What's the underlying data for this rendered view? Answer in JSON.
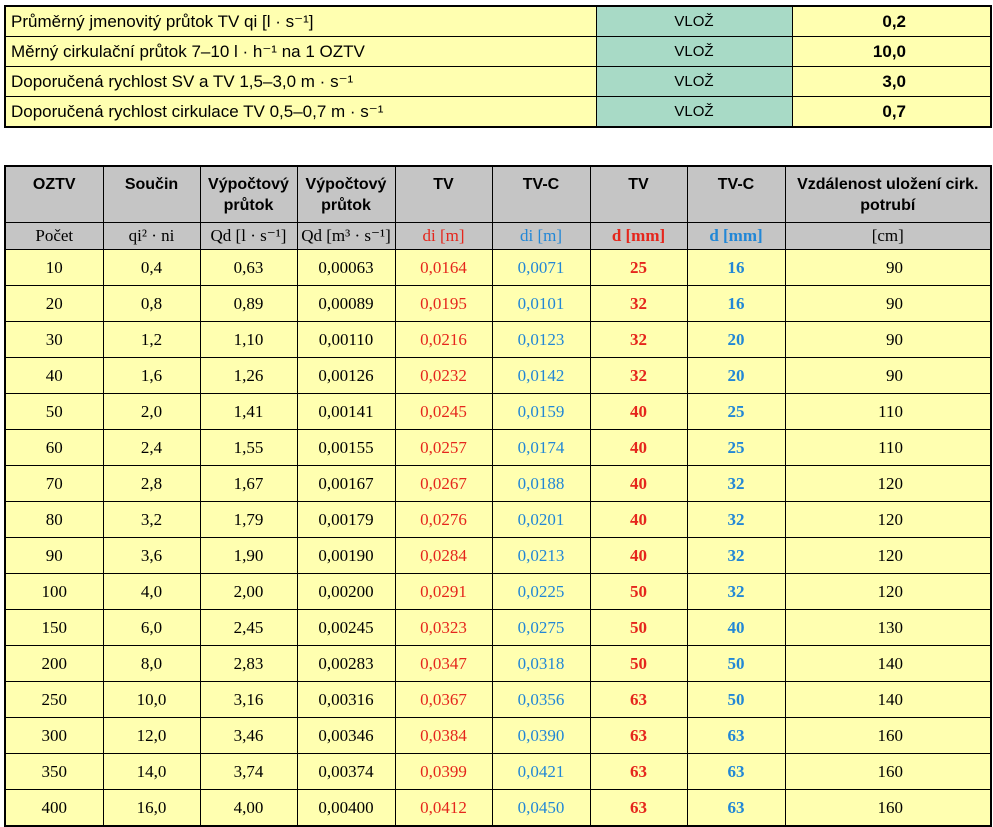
{
  "params": [
    {
      "label": "Průměrný jmenovitý průtok TV qi  [l · s⁻¹]",
      "button": "VLOŽ",
      "value": "0,2"
    },
    {
      "label": "Měrný cirkulační průtok 7–10 l · h⁻¹ na 1 OZTV",
      "button": "VLOŽ",
      "value": "10,0"
    },
    {
      "label": "Doporučená rychlost SV a TV 1,5–3,0 m · s⁻¹",
      "button": "VLOŽ",
      "value": "3,0"
    },
    {
      "label": "Doporučená rychlost cirkulace TV 0,5–0,7 m · s⁻¹",
      "button": "VLOŽ",
      "value": "0,7"
    }
  ],
  "table": {
    "headers": [
      "OZTV",
      "Součin",
      "Výpočtový průtok",
      "Výpočtový průtok",
      "TV",
      "TV-C",
      "TV",
      "TV-C",
      "Vzdálenost uložení cirk. potrubí"
    ],
    "units": [
      "Počet",
      "qi² · ni",
      "Qd [l · s⁻¹]",
      "Qd [m³ · s⁻¹]",
      "di [m]",
      "di [m]",
      "d [mm]",
      "d [mm]",
      "[cm]"
    ],
    "rows": [
      [
        "10",
        "0,4",
        "0,63",
        "0,00063",
        "0,0164",
        "0,0071",
        "25",
        "16",
        "90"
      ],
      [
        "20",
        "0,8",
        "0,89",
        "0,00089",
        "0,0195",
        "0,0101",
        "32",
        "16",
        "90"
      ],
      [
        "30",
        "1,2",
        "1,10",
        "0,00110",
        "0,0216",
        "0,0123",
        "32",
        "20",
        "90"
      ],
      [
        "40",
        "1,6",
        "1,26",
        "0,00126",
        "0,0232",
        "0,0142",
        "32",
        "20",
        "90"
      ],
      [
        "50",
        "2,0",
        "1,41",
        "0,00141",
        "0,0245",
        "0,0159",
        "40",
        "25",
        "110"
      ],
      [
        "60",
        "2,4",
        "1,55",
        "0,00155",
        "0,0257",
        "0,0174",
        "40",
        "25",
        "110"
      ],
      [
        "70",
        "2,8",
        "1,67",
        "0,00167",
        "0,0267",
        "0,0188",
        "40",
        "32",
        "120"
      ],
      [
        "80",
        "3,2",
        "1,79",
        "0,00179",
        "0,0276",
        "0,0201",
        "40",
        "32",
        "120"
      ],
      [
        "90",
        "3,6",
        "1,90",
        "0,00190",
        "0,0284",
        "0,0213",
        "40",
        "32",
        "120"
      ],
      [
        "100",
        "4,0",
        "2,00",
        "0,00200",
        "0,0291",
        "0,0225",
        "50",
        "32",
        "120"
      ],
      [
        "150",
        "6,0",
        "2,45",
        "0,00245",
        "0,0323",
        "0,0275",
        "50",
        "40",
        "130"
      ],
      [
        "200",
        "8,0",
        "2,83",
        "0,00283",
        "0,0347",
        "0,0318",
        "50",
        "50",
        "140"
      ],
      [
        "250",
        "10,0",
        "3,16",
        "0,00316",
        "0,0367",
        "0,0356",
        "63",
        "50",
        "140"
      ],
      [
        "300",
        "12,0",
        "3,46",
        "0,00346",
        "0,0384",
        "0,0390",
        "63",
        "63",
        "160"
      ],
      [
        "350",
        "14,0",
        "3,74",
        "0,00374",
        "0,0399",
        "0,0421",
        "63",
        "63",
        "160"
      ],
      [
        "400",
        "16,0",
        "4,00",
        "0,00400",
        "0,0412",
        "0,0450",
        "63",
        "63",
        "160"
      ]
    ]
  },
  "colors": {
    "cell_yellow": "#ffffb0",
    "button_green": "#a8dac6",
    "header_gray": "#c5c5c5",
    "red": "#e5261c",
    "blue": "#2287d6"
  }
}
